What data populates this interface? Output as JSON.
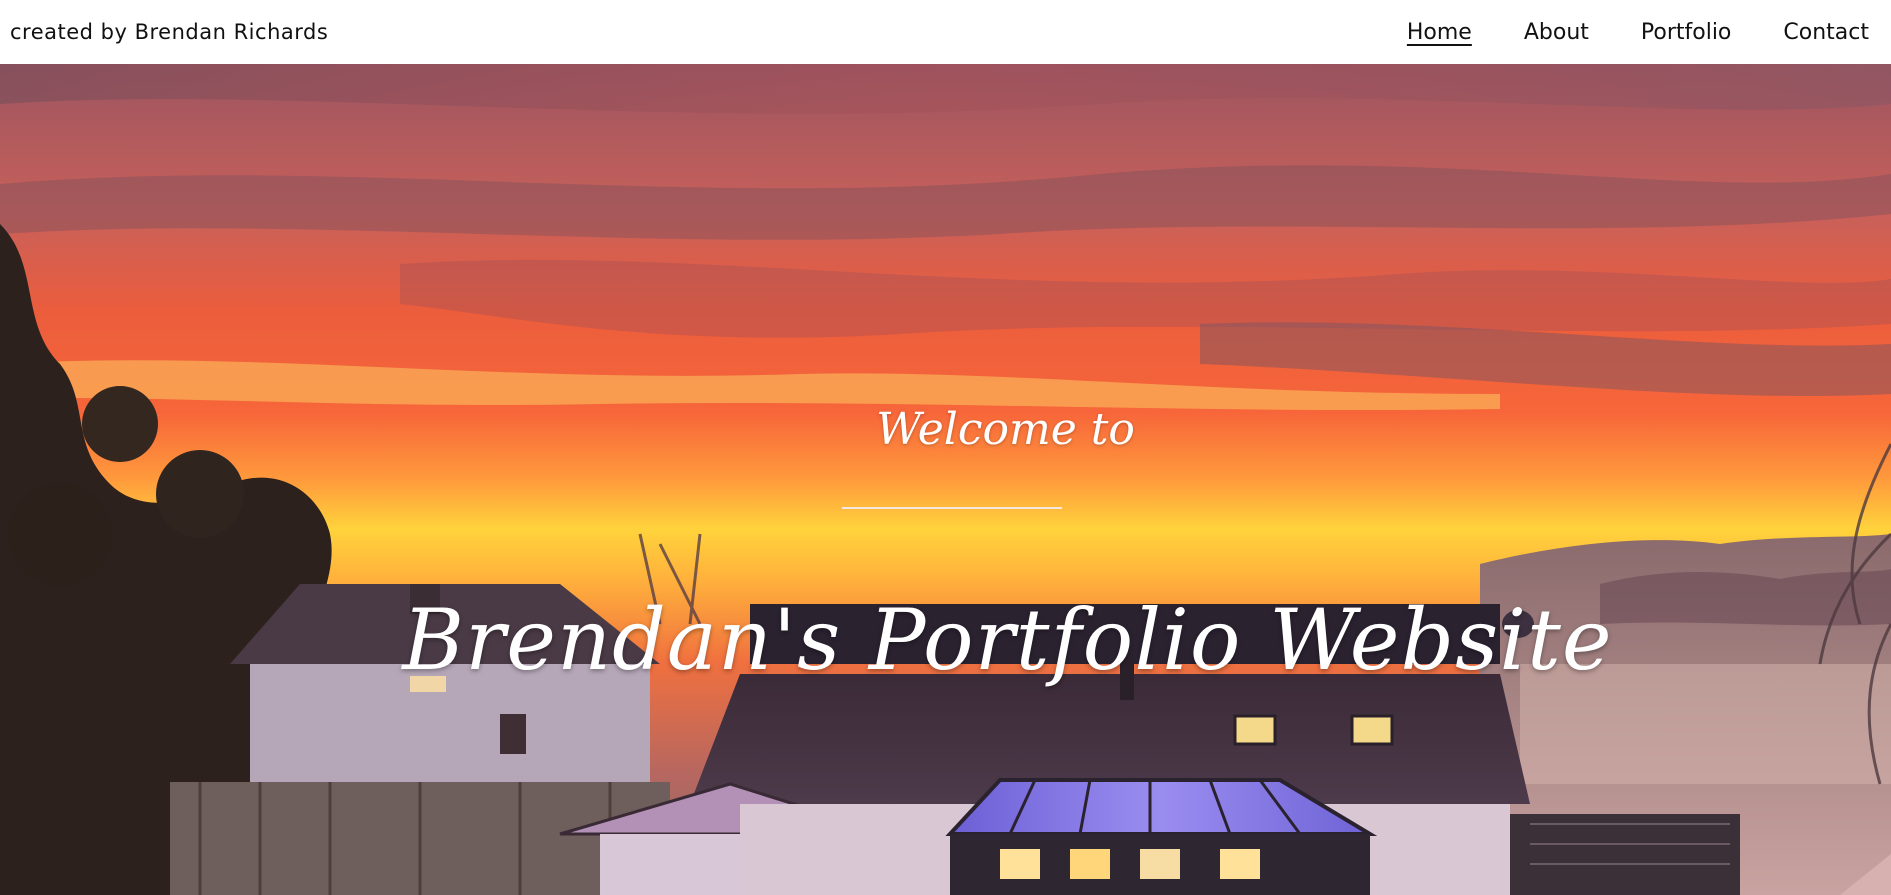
{
  "header": {
    "brand": "created by Brendan Richards",
    "nav": [
      {
        "label": "Home",
        "active": true
      },
      {
        "label": "About",
        "active": false
      },
      {
        "label": "Portfolio",
        "active": false
      },
      {
        "label": "Contact",
        "active": false
      }
    ]
  },
  "hero": {
    "welcome": "Welcome to",
    "title": "Brendan's Portfolio Website"
  },
  "colors": {
    "header_bg": "#ffffff",
    "nav_text": "#111111",
    "hero_text": "#ffffff",
    "sky_top": "#8a4f57",
    "sky_orange": "#f26a3a",
    "sky_yellow": "#ffd63b"
  }
}
